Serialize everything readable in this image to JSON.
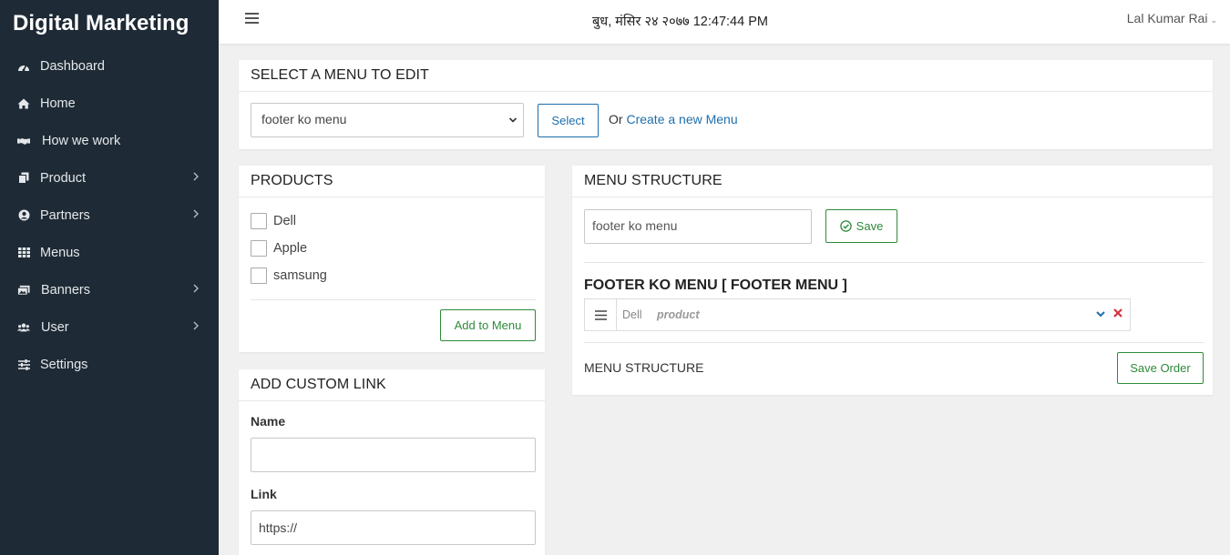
{
  "brand": "Digital Marketing",
  "sidebar": {
    "items": [
      {
        "label": "Dashboard",
        "icon": "dashboard-icon",
        "has_submenu": false
      },
      {
        "label": "Home",
        "icon": "home-icon",
        "has_submenu": false
      },
      {
        "label": "How we work",
        "icon": "handshake-icon",
        "has_submenu": false
      },
      {
        "label": "Product",
        "icon": "copy-icon",
        "has_submenu": true
      },
      {
        "label": "Partners",
        "icon": "user-circle-icon",
        "has_submenu": true
      },
      {
        "label": "Menus",
        "icon": "grid-icon",
        "has_submenu": false
      },
      {
        "label": "Banners",
        "icon": "images-icon",
        "has_submenu": true
      },
      {
        "label": "User",
        "icon": "users-icon",
        "has_submenu": true
      },
      {
        "label": "Settings",
        "icon": "sliders-icon",
        "has_submenu": false
      }
    ]
  },
  "topbar": {
    "datetime": "बुध, मंसिर २४ २०७७ 12:47:44 PM",
    "user": "Lal Kumar Rai"
  },
  "select_menu": {
    "title": "SELECT A MENU TO EDIT",
    "selected": "footer ko menu",
    "select_button": "Select",
    "or_text": "Or",
    "create_link": "Create a new Menu"
  },
  "products": {
    "title": "PRODUCTS",
    "items": [
      "Dell",
      "Apple",
      "samsung"
    ],
    "add_button": "Add to Menu"
  },
  "custom_link": {
    "title": "ADD CUSTOM LINK",
    "name_label": "Name",
    "name_value": "",
    "link_label": "Link",
    "link_value": "https://"
  },
  "menu_structure": {
    "title": "MENU STRUCTURE",
    "menu_name": "footer ko menu",
    "save_button": "Save",
    "structure_title": "FOOTER KO MENU [ FOOTER MENU ]",
    "items": [
      {
        "name": "Dell",
        "type": "product"
      }
    ],
    "footer_label": "MENU STRUCTURE",
    "save_order_button": "Save Order"
  },
  "colors": {
    "sidebar_bg": "#1e2a35",
    "link_blue": "#1f6eab",
    "success_green": "#2e8b3a",
    "remove_red": "#d9303c"
  }
}
